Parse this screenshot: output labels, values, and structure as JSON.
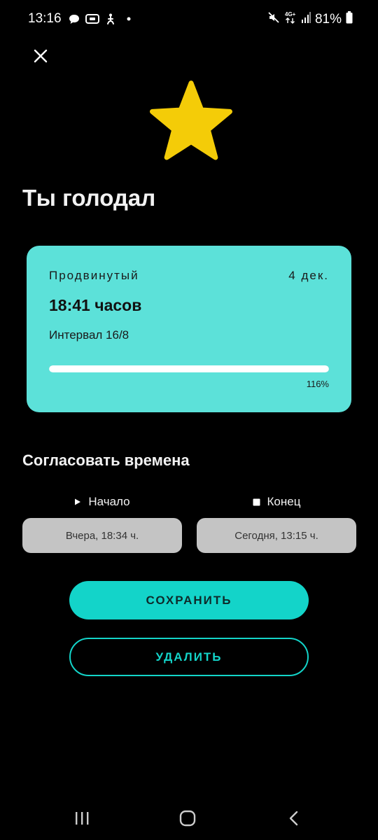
{
  "status_bar": {
    "time": "13:16",
    "battery": "81%",
    "icons_left": [
      "message-icon",
      "screen-record-icon",
      "accessibility-icon",
      "dot-icon"
    ],
    "icons_right": [
      "mute-icon",
      "4g-data-icon",
      "signal-icon",
      "battery-icon"
    ],
    "network_label": "4G+"
  },
  "header": {
    "close_icon": "close-icon",
    "star_icon": "star-icon",
    "star_color": "#f4cc08",
    "title": "Ты голодал"
  },
  "card": {
    "level": "Продвинутый",
    "date": "4 дек.",
    "duration": "18:41 часов",
    "interval": "Интервал 16/8",
    "progress_percent": 116,
    "progress_label": "116%",
    "background": "#5ce1d9"
  },
  "times": {
    "section_title": "Согласовать времена",
    "start_label": "Начало",
    "start_value": "Вчера, 18:34 ч.",
    "end_label": "Конец",
    "end_value": "Сегодня, 13:15 ч."
  },
  "actions": {
    "save_label": "СОХРАНИТЬ",
    "delete_label": "УДАЛИТЬ",
    "accent": "#13d4c9"
  },
  "nav_bar": {
    "icons": [
      "recents-icon",
      "home-icon",
      "back-icon"
    ]
  }
}
